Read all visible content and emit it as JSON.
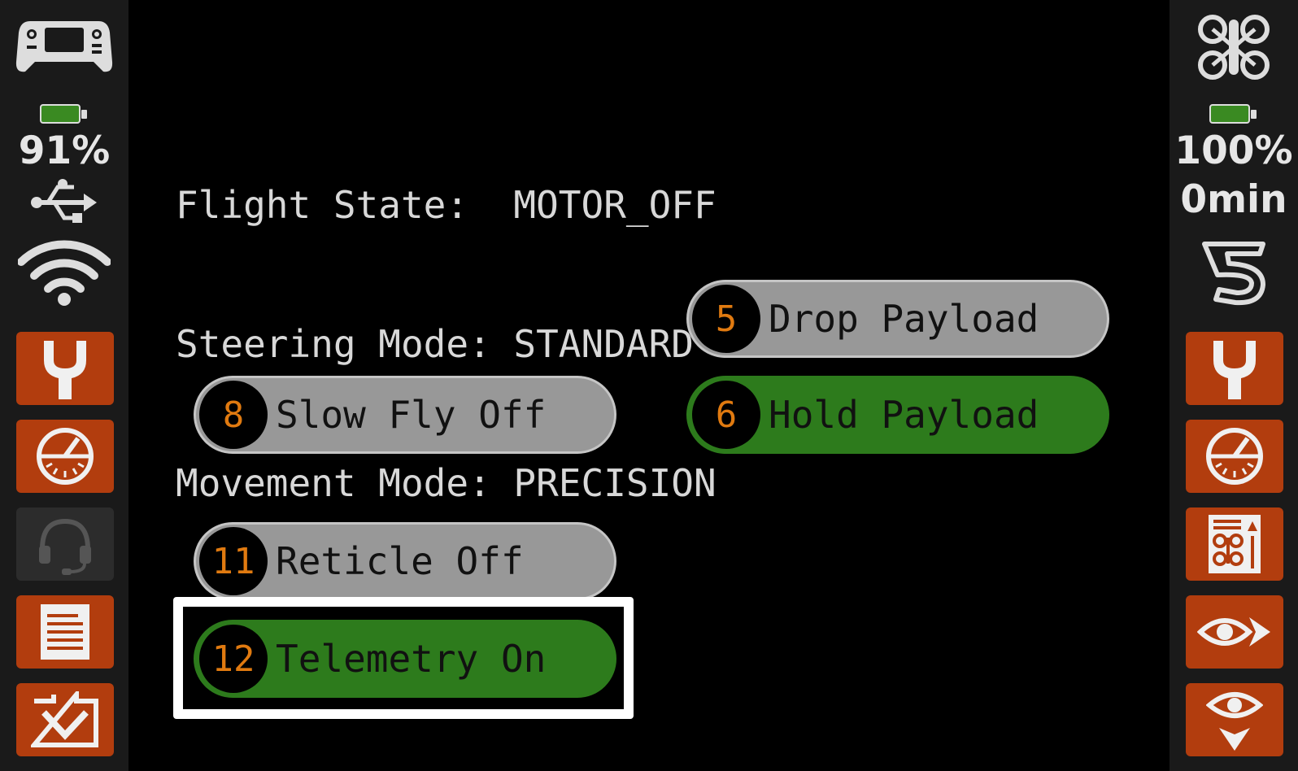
{
  "left_sidebar": {
    "battery_percent": "91%",
    "battery_level": 0.91,
    "icons": [
      "gamepad-icon",
      "battery-icon",
      "usb-icon",
      "wifi-icon"
    ],
    "buttons": [
      {
        "name": "wrench-button",
        "icon": "wrench-icon",
        "enabled": true
      },
      {
        "name": "gauge-button",
        "icon": "gauge-icon",
        "enabled": true
      },
      {
        "name": "headset-button",
        "icon": "headset-icon",
        "enabled": false
      },
      {
        "name": "document-button",
        "icon": "document-icon",
        "enabled": true
      },
      {
        "name": "tray-down-button",
        "icon": "tray-down-icon",
        "enabled": true
      }
    ]
  },
  "right_sidebar": {
    "battery_percent": "100%",
    "flight_time": "0min",
    "battery_level": 1.0,
    "icons": [
      "drone-icon",
      "battery-icon",
      "lap-counter-icon"
    ],
    "buttons": [
      {
        "name": "wrench-button",
        "icon": "wrench-icon",
        "enabled": true
      },
      {
        "name": "gauge-button",
        "icon": "gauge-icon",
        "enabled": true
      },
      {
        "name": "drone-config-button",
        "icon": "drone-config-icon",
        "enabled": true
      },
      {
        "name": "eye-forward-button",
        "icon": "eye-forward-icon",
        "enabled": true
      },
      {
        "name": "eye-down-button",
        "icon": "eye-down-icon",
        "enabled": true
      }
    ]
  },
  "status": {
    "flight_state": "Flight State:  MOTOR_OFF",
    "steering_mode": "Steering Mode: STANDARD",
    "movement_mode": "Movement Mode: PRECISION"
  },
  "actions": {
    "drop_payload": {
      "number": "5",
      "label": "Drop Payload",
      "active": false
    },
    "hold_payload": {
      "number": "6",
      "label": "Hold Payload",
      "active": true
    },
    "slow_fly": {
      "number": "8",
      "label": "Slow Fly Off",
      "active": false
    },
    "reticle": {
      "number": "11",
      "label": "Reticle Off",
      "active": false
    },
    "telemetry": {
      "number": "12",
      "label": "Telemetry On",
      "active": true
    }
  },
  "colors": {
    "accent_orange": "#b23d0e",
    "active_green": "#2d7b1c",
    "inactive_grey": "#989898",
    "number_orange": "#e07a10",
    "text_light": "#d8d8d8"
  }
}
